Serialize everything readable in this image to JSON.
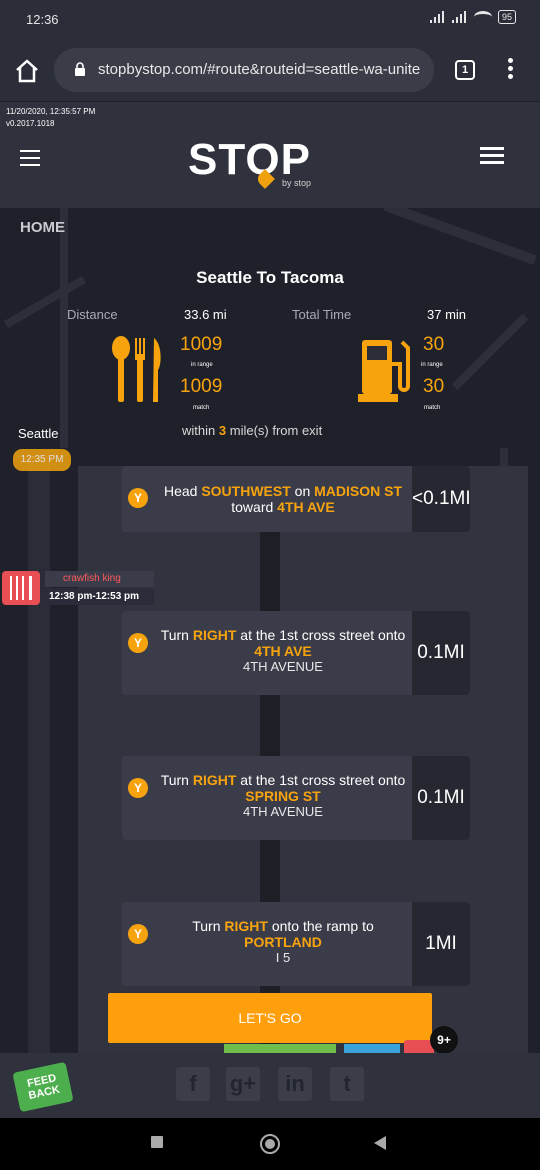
{
  "status": {
    "time": "12:36",
    "battery": "95"
  },
  "browser": {
    "url": "stopbystop.com/#route&routeid=seattle-wa-unite",
    "tab_count": "1"
  },
  "header": {
    "timestamp": "11/20/2020, 12:35:57 PM",
    "version": "v0.2017.1018",
    "logo": "STOP",
    "logo_sub": "by stop"
  },
  "nav": {
    "home": "HOME"
  },
  "route": {
    "title": "Seattle To Tacoma",
    "distance_label": "Distance",
    "distance_value": "33.6 mi",
    "time_label": "Total Time",
    "time_value": "37 min",
    "food_in_range": "1009",
    "food_match": "1009",
    "gas_in_range": "30",
    "gas_match": "30",
    "in_range_label": "in range",
    "match_label": "match",
    "within_prefix": "within",
    "within_value": "3",
    "within_suffix": "mile(s) from exit"
  },
  "start": {
    "city": "Seattle",
    "time": "12:35 PM"
  },
  "poi": {
    "name": "crawfish king",
    "time": "12:38 pm-12:53 pm"
  },
  "steps": [
    {
      "t1": "Head ",
      "h1": "SOUTHWEST",
      "t2": " on ",
      "h2": "MADISON",
      "t3": "",
      "h3": "ST",
      "t4": " toward ",
      "h4": "4TH AVE",
      "sub": "",
      "dist": "<0.1MI"
    },
    {
      "t1": "Turn ",
      "h1": "RIGHT",
      "t2": " at the 1st cross street onto ",
      "h2": "4TH AVE",
      "sub": "4TH AVENUE",
      "dist": "0.1MI"
    },
    {
      "t1": "Turn ",
      "h1": "RIGHT",
      "t2": " at the 1st cross street onto ",
      "h2": "SPRING ST",
      "sub": "4TH AVENUE",
      "dist": "0.1MI"
    },
    {
      "t1": "Turn ",
      "h1": "RIGHT",
      "t2": " onto the ramp to ",
      "h2": "PORTLAND",
      "sub": "I 5",
      "dist": "1MI"
    }
  ],
  "actions": {
    "go": "LET'S GO",
    "more_count": "9+"
  },
  "footer": {
    "feedback": "FEED BACK",
    "social": [
      "f",
      "g+",
      "in",
      "t"
    ]
  },
  "colors": {
    "accent": "#f7a30e",
    "bg": "#2a2d38",
    "poi": "#e84f55",
    "feedback": "#4cae4c"
  }
}
